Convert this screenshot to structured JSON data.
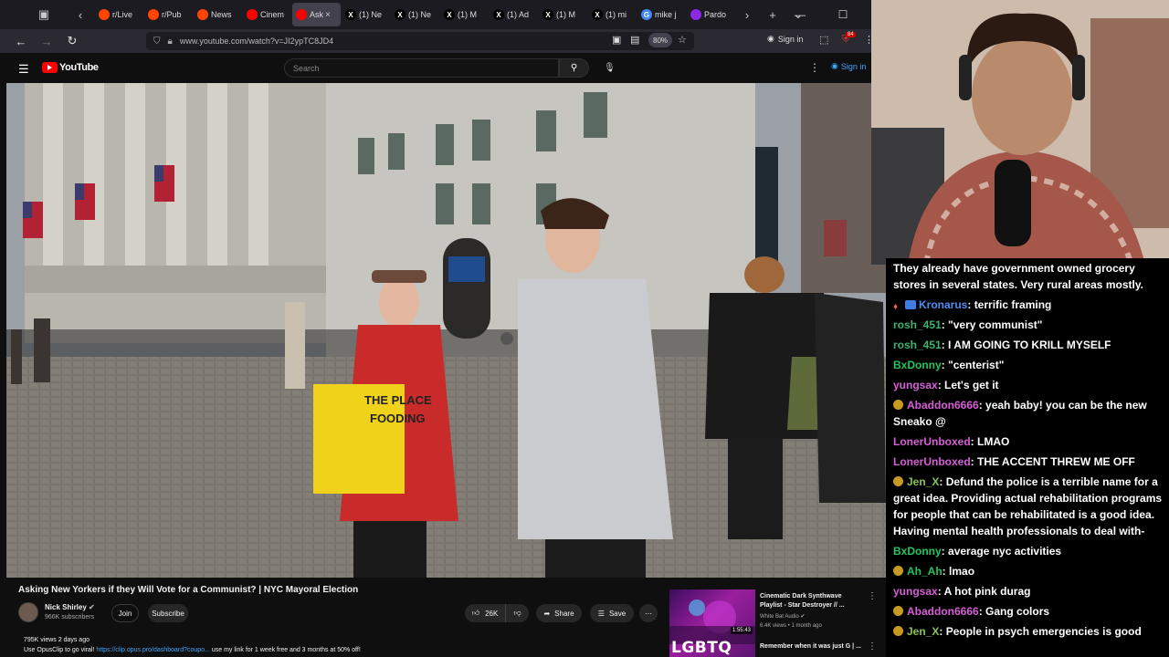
{
  "browser": {
    "tabs": [
      {
        "label": "r/Live",
        "icon_color": "#ff4500",
        "icon": "reddit-icon"
      },
      {
        "label": "r/Pub",
        "icon_color": "#ff4500",
        "icon": "reddit-icon"
      },
      {
        "label": "News",
        "icon_color": "#ff4500",
        "icon": "reddit-icon"
      },
      {
        "label": "Cinem",
        "icon_color": "#ff0000",
        "icon": "youtube-icon"
      },
      {
        "label": "Ask",
        "icon_color": "#ff0000",
        "icon": "youtube-icon",
        "active": true
      },
      {
        "label": "(1) Ne",
        "icon_color": "#000000",
        "icon": "x-icon"
      },
      {
        "label": "(1) Ne",
        "icon_color": "#000000",
        "icon": "x-icon"
      },
      {
        "label": "(1) M",
        "icon_color": "#000000",
        "icon": "x-icon"
      },
      {
        "label": "(1) Ad",
        "icon_color": "#000000",
        "icon": "x-icon"
      },
      {
        "label": "(1) M",
        "icon_color": "#000000",
        "icon": "x-icon"
      },
      {
        "label": "(1) mi",
        "icon_color": "#000000",
        "icon": "x-icon"
      },
      {
        "label": "mike j",
        "icon_color": "#4285f4",
        "icon": "google-icon"
      },
      {
        "label": "Pardo",
        "icon_color": "#8a2be2",
        "icon": "pocket-icon"
      }
    ],
    "url": "www.youtube.com/watch?v=JI2ypTC8JD4",
    "zoom": "80%",
    "signin_label": "Sign in",
    "ext_badge": "84"
  },
  "youtube": {
    "logo_text": "YouTube",
    "search_placeholder": "Search",
    "signin_label": "Sign in"
  },
  "video": {
    "title": "Asking New Yorkers if they Will Vote for a Communist? | NYC Mayoral Election",
    "channel": "Nick Shirley",
    "subscribers": "966K subscribers",
    "join_label": "Join",
    "subscribe_label": "Subscribe",
    "likes": "26K",
    "share_label": "Share",
    "save_label": "Save",
    "stats": "795K views  2 days ago",
    "desc_prefix": "Use OpusClip to go viral!",
    "desc_link": "https://clip.opus.pro/dashboard?coupo...",
    "desc_suffix": "use my link for 1 week free and 3 months at 50% off!"
  },
  "recommended": {
    "title": "Cinematic Dark Synthwave Playlist - Star Destroyer // ...",
    "channel": "White Bat Audio",
    "meta": "6.4K views • 1 month ago",
    "duration": "1:55:43",
    "thumb_text": "LGBTQ",
    "next_title": "Remember when it was just G | ..."
  },
  "chat": [
    {
      "user": "",
      "color": "#ffffff",
      "text": "They already have government owned grocery stores in several states. Very rural areas mostly.",
      "badge": "none"
    },
    {
      "user": "Kronarus",
      "color": "#4f8ef7",
      "text": "terrific framing",
      "badge": "multi"
    },
    {
      "user": "rosh_451",
      "color": "#3cb371",
      "text": "\"very communist\"",
      "badge": "none"
    },
    {
      "user": "rosh_451",
      "color": "#3cb371",
      "text": "I AM GOING TO KRILL MYSELF",
      "badge": "none"
    },
    {
      "user": "BxDonny",
      "color": "#22c55e",
      "text": "\"centerist\"",
      "badge": "none"
    },
    {
      "user": "yungsax",
      "color": "#d65fd6",
      "text": "Let's get it",
      "badge": "none"
    },
    {
      "user": "Abaddon6666",
      "color": "#d65fd6",
      "text": "yeah baby! you can be the new Sneako @",
      "badge": "gold"
    },
    {
      "user": "LonerUnboxed",
      "color": "#d65fd6",
      "text": "LMAO",
      "badge": "none"
    },
    {
      "user": "LonerUnboxed",
      "color": "#d65fd6",
      "text": "THE ACCENT THREW ME OFF",
      "badge": "none"
    },
    {
      "user": "Jen_X",
      "color": "#8bc34a",
      "text": "Defund the police is a terrible name for a great idea. Providing actual rehabilitation programs for people that can be rehabilitated is a good idea. Having mental health professionals to deal with-",
      "badge": "gold"
    },
    {
      "user": "BxDonny",
      "color": "#22c55e",
      "text": "average nyc activities",
      "badge": "none"
    },
    {
      "user": "Ah_Ah",
      "color": "#22c55e",
      "text": "lmao",
      "badge": "gold"
    },
    {
      "user": "yungsax",
      "color": "#d65fd6",
      "text": "A hot pink durag",
      "badge": "none"
    },
    {
      "user": "Abaddon6666",
      "color": "#d65fd6",
      "text": "Gang colors",
      "badge": "gold"
    },
    {
      "user": "Jen_X",
      "color": "#8bc34a",
      "text": "People in psych emergencies is good",
      "badge": "gold"
    }
  ]
}
